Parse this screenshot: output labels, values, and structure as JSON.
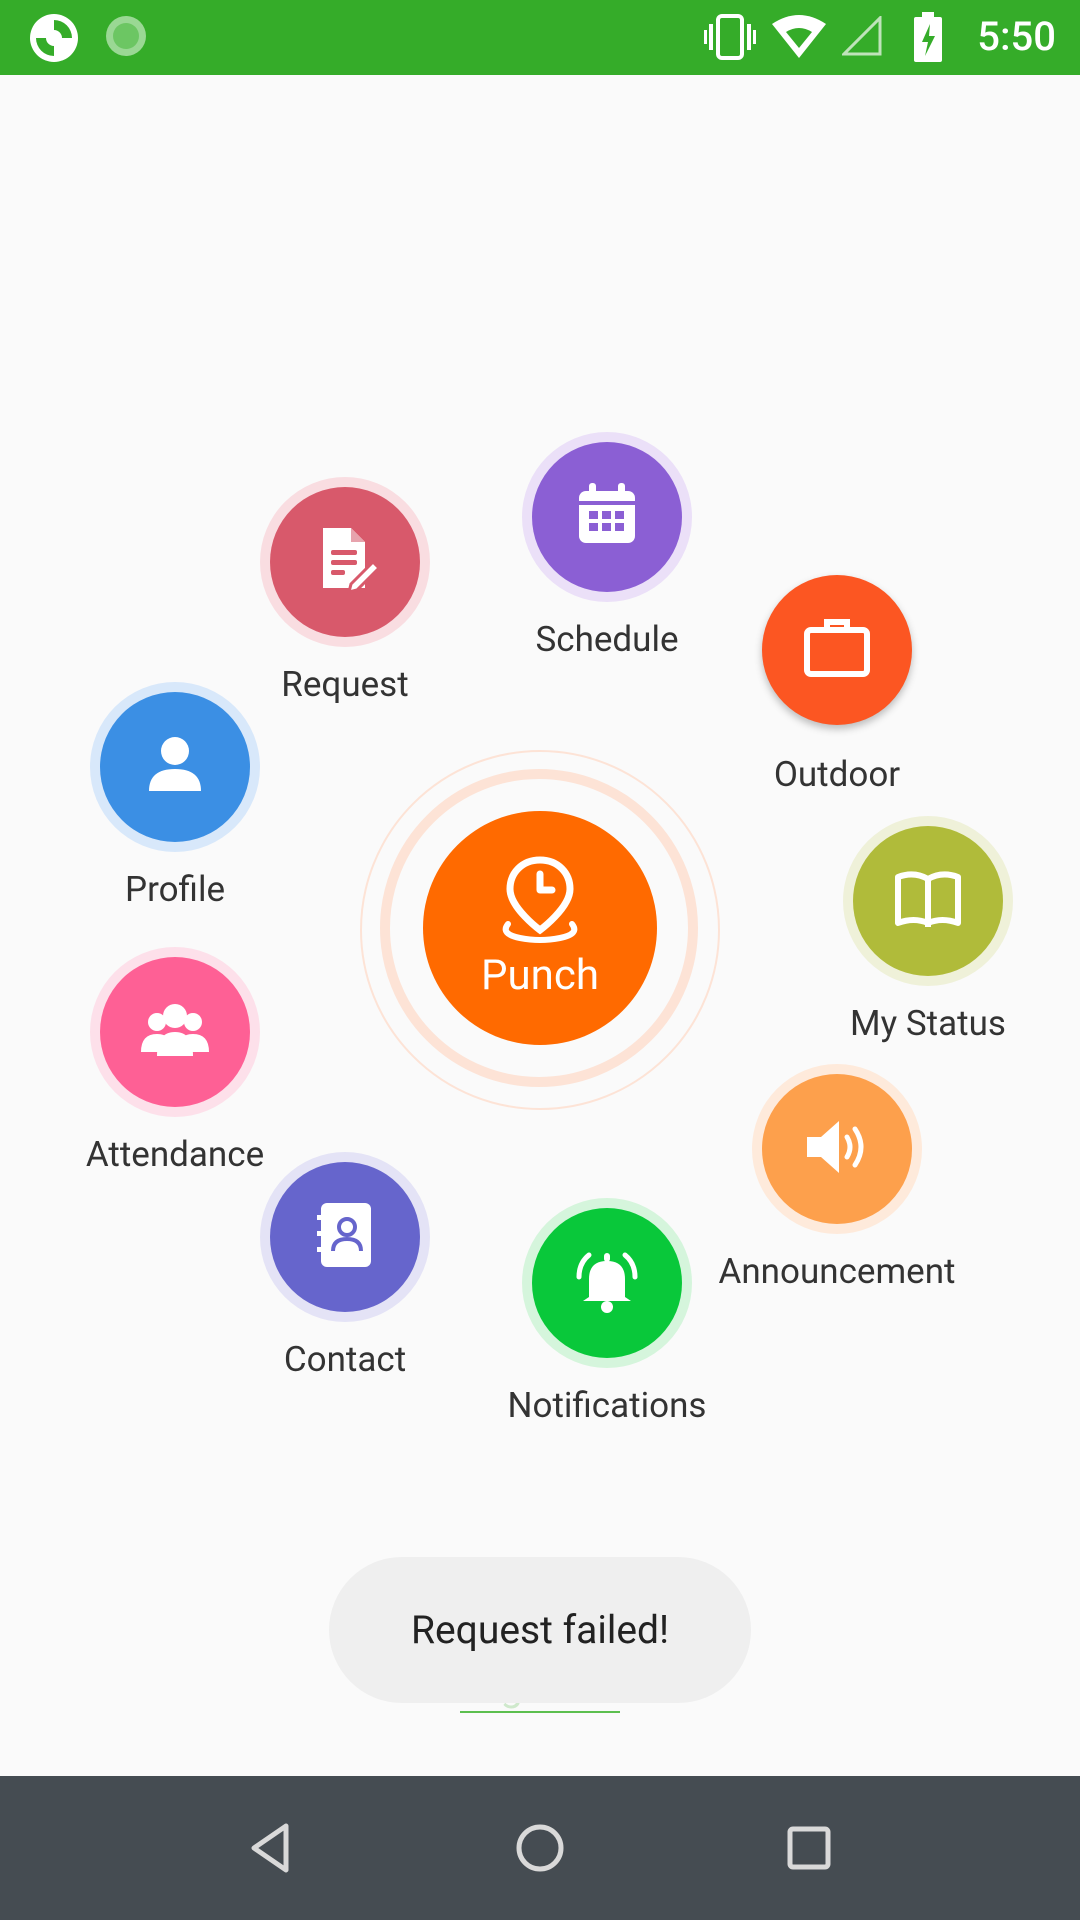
{
  "status_bar": {
    "time": "5:50",
    "icons": [
      "app-logo-icon",
      "sync-icon",
      "vibrate-icon",
      "wifi-icon",
      "no-signal-icon",
      "battery-charging-icon"
    ]
  },
  "punch": {
    "label": "Punch",
    "color": "#ff6a00"
  },
  "menu": [
    {
      "id": "request",
      "label": "Request",
      "icon": "document-edit-icon",
      "color": "#d8596b"
    },
    {
      "id": "schedule",
      "label": "Schedule",
      "icon": "calendar-icon",
      "color": "#8b5fd4"
    },
    {
      "id": "outdoor",
      "label": "Outdoor",
      "icon": "briefcase-icon",
      "color": "#fc5622"
    },
    {
      "id": "profile",
      "label": "Profile",
      "icon": "person-icon",
      "color": "#3b8fe4"
    },
    {
      "id": "my-status",
      "label": "My Status",
      "icon": "book-icon",
      "color": "#b0bb3a"
    },
    {
      "id": "attendance",
      "label": "Attendance",
      "icon": "group-icon",
      "color": "#fe6095"
    },
    {
      "id": "announcement",
      "label": "Announcement",
      "icon": "speaker-icon",
      "color": "#fda04c"
    },
    {
      "id": "contact",
      "label": "Contact",
      "icon": "contact-book-icon",
      "color": "#6665cc"
    },
    {
      "id": "notifications",
      "label": "Notifications",
      "icon": "bell-icon",
      "color": "#09c83a"
    }
  ],
  "toast": {
    "text": "Request failed!"
  },
  "sign_out": {
    "label": "Sign out"
  },
  "nav": {
    "icons": [
      "back-icon",
      "home-icon",
      "recents-icon"
    ]
  }
}
